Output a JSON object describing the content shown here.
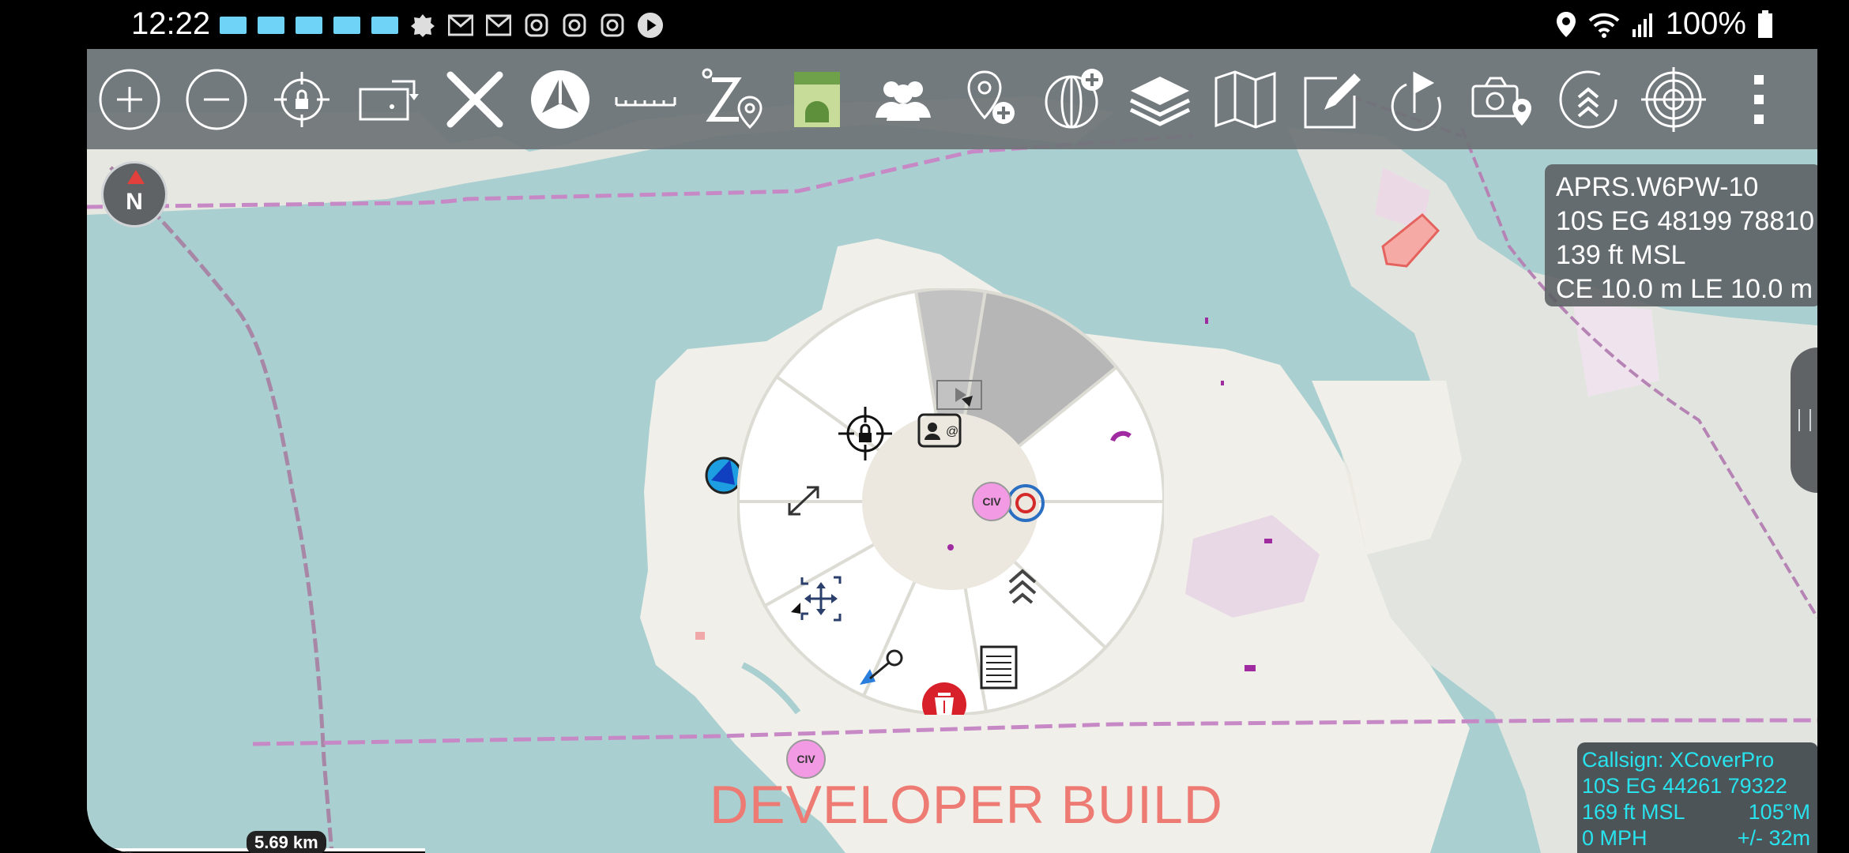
{
  "status_bar": {
    "time": "12:22",
    "battery": "100%",
    "notification_icons": [
      "tile",
      "tile",
      "tile",
      "tile",
      "tile",
      "gear",
      "gmail",
      "gmail",
      "instagram",
      "instagram",
      "instagram",
      "play"
    ]
  },
  "toolbar": {
    "buttons": [
      "zoom-in",
      "zoom-out",
      "lock-on-self",
      "rotate-map",
      "close",
      "nav-mode",
      "range-bearing",
      "elevation-tool",
      "android-plugin",
      "contacts",
      "point-dropper",
      "add-overlay",
      "layers",
      "maps",
      "drawing-tools",
      "route",
      "geo-camera",
      "elevation-arrows",
      "target",
      "overflow-menu"
    ]
  },
  "compass": {
    "label": "N"
  },
  "target_info": {
    "callsign": "APRS.W6PW-10",
    "mgrs": "10S EG 48199 78810",
    "altitude": "139 ft MSL",
    "error": "CE 10.0 m LE 10.0 m"
  },
  "self_info": {
    "callsign": "Callsign: XCoverPro",
    "mgrs": "10S  EG  44261  79322",
    "altitude": "169 ft MSL",
    "heading": "105°M",
    "speed": "0 MPH",
    "accuracy": "+/- 32m"
  },
  "watermark": "DEVELOPER BUILD",
  "scale_bar": {
    "label": "5.69 km"
  },
  "radial_menu": {
    "center_marker": "CIV",
    "segments": [
      "video",
      "contact-card",
      "bullseye",
      "breadcrumbs",
      "details",
      "delete",
      "range-bearing-line",
      "drag-move",
      "resize",
      "lock-on"
    ]
  },
  "map_markers": {
    "civ_label": "CIV"
  },
  "colors": {
    "toolbar": "#6e7376",
    "accent_cyan": "#28e3ee",
    "watermark": "#ee7a74",
    "delete_red": "#d8202a"
  }
}
